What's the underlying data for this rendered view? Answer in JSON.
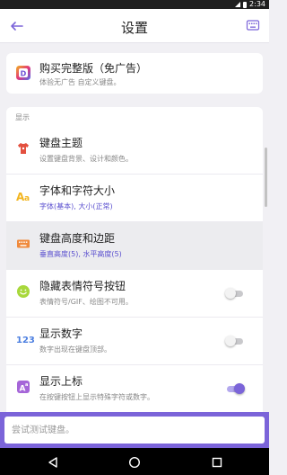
{
  "status_bar": {
    "time": "2:34"
  },
  "app_bar": {
    "title": "设置",
    "back_icon": "arrow-left-icon",
    "keyboard_icon": "keyboard-icon"
  },
  "premium": {
    "title": "购买完整版（免广告）",
    "subtitle": "体验无广告 自定义键盘。",
    "icon": "app-logo-icon"
  },
  "display_section": {
    "label": "显示",
    "items": [
      {
        "title": "键盘主题",
        "subtitle": "设置键盘背景、设计和颜色。",
        "icon": "tshirt-icon",
        "subtitle_accent": false
      },
      {
        "title": "字体和字符大小",
        "subtitle": "字体(基本), 大小(正常)",
        "icon": "font-size-icon",
        "subtitle_accent": true
      },
      {
        "title": "键盘高度和边距",
        "subtitle": "垂直高度(5), 水平高度(5)",
        "icon": "keyboard-size-icon",
        "subtitle_accent": true
      },
      {
        "title": "隐藏表情符号按钮",
        "subtitle": "表情符号/GIF、绘图不可用。",
        "icon": "smiley-icon",
        "toggle": false
      },
      {
        "title": "显示数字",
        "subtitle": "数字出现在键盘顶部。",
        "icon": "numbers-icon",
        "toggle": false
      },
      {
        "title": "显示上标",
        "subtitle": "在按键按钮上显示特殊字符或数字。",
        "icon": "superscript-icon",
        "toggle": true
      }
    ]
  },
  "test_input": {
    "placeholder": "尝试测试键盘。"
  },
  "colors": {
    "accent": "#7b64d9",
    "accent_text": "#5a4fcf",
    "background": "#f1f0f4",
    "highlight_row": "#ececef"
  }
}
